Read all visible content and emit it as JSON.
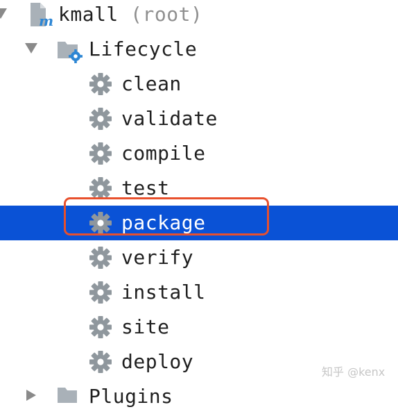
{
  "tree": {
    "root": {
      "name": "kmall",
      "suffix": "(root)",
      "icon": "maven-module-icon"
    },
    "lifecycle": {
      "label": "Lifecycle",
      "icon": "lifecycle-folder-icon"
    },
    "phases": [
      {
        "label": "clean",
        "icon": "gear-icon"
      },
      {
        "label": "validate",
        "icon": "gear-icon"
      },
      {
        "label": "compile",
        "icon": "gear-icon"
      },
      {
        "label": "test",
        "icon": "gear-icon"
      },
      {
        "label": "package",
        "icon": "gear-icon",
        "selected": true
      },
      {
        "label": "verify",
        "icon": "gear-icon"
      },
      {
        "label": "install",
        "icon": "gear-icon"
      },
      {
        "label": "site",
        "icon": "gear-icon"
      },
      {
        "label": "deploy",
        "icon": "gear-icon"
      }
    ],
    "plugins": {
      "label": "Plugins"
    }
  },
  "watermark": "知乎 @kenx",
  "colors": {
    "selection": "#0a52d6",
    "highlight_border": "#e8502c",
    "gear": "#8f979d"
  }
}
